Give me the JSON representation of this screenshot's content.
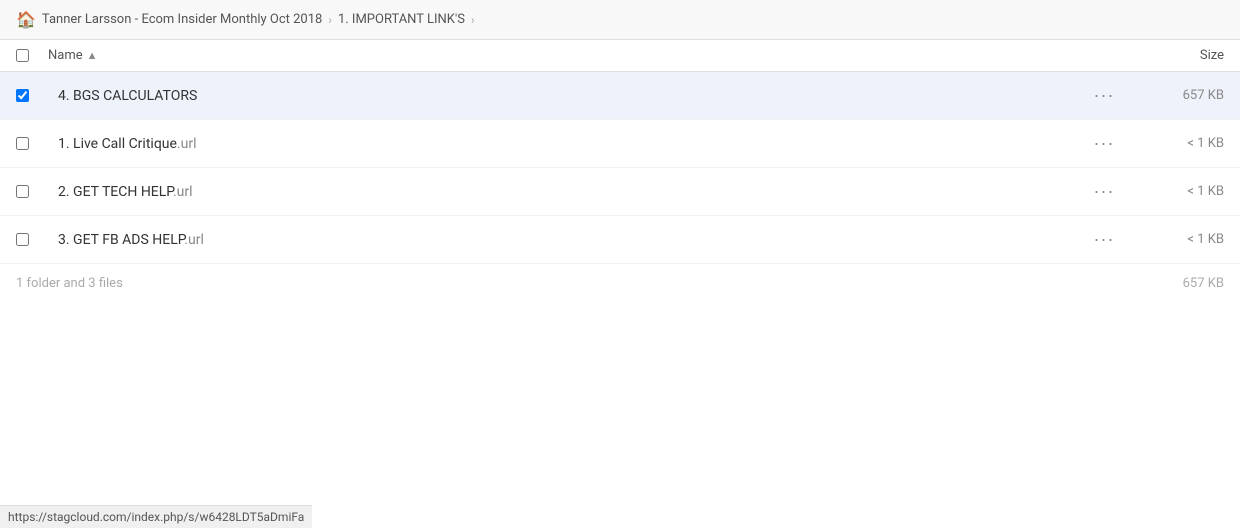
{
  "breadcrumb": {
    "home_icon": "🏠",
    "root_label": "Tanner Larsson - Ecom Insider Monthly Oct 2018",
    "separator": "›",
    "current_label": "1. IMPORTANT LINK'S",
    "separator2": "›"
  },
  "table": {
    "checkbox_all": false,
    "name_col_label": "Name",
    "sort_arrow": "▲",
    "size_col_label": "Size"
  },
  "items": [
    {
      "id": "item-1",
      "type": "folder",
      "name": "4. BGS CALCULATORS",
      "name_base": "4. BGS CALCULATORS",
      "ext": "",
      "size": "657 KB",
      "selected": true
    },
    {
      "id": "item-2",
      "type": "file",
      "name": "1. Live Call Critique",
      "name_base": "1. Live Call Critique",
      "ext": ".url",
      "size": "< 1 KB",
      "selected": false
    },
    {
      "id": "item-3",
      "type": "file",
      "name": "2. GET TECH HELP",
      "name_base": "2. GET TECH HELP",
      "ext": ".url",
      "size": "< 1 KB",
      "selected": false
    },
    {
      "id": "item-4",
      "type": "file",
      "name": "3. GET FB ADS HELP",
      "name_base": "3. GET FB ADS HELP",
      "ext": ".url",
      "size": "< 1 KB",
      "selected": false
    }
  ],
  "summary": {
    "text": "1 folder and 3 files",
    "total_size": "657 KB"
  },
  "status_bar": {
    "url": "https://stagcloud.com/index.php/s/w6428LDT5aDmiFa"
  },
  "more_button_label": "···"
}
